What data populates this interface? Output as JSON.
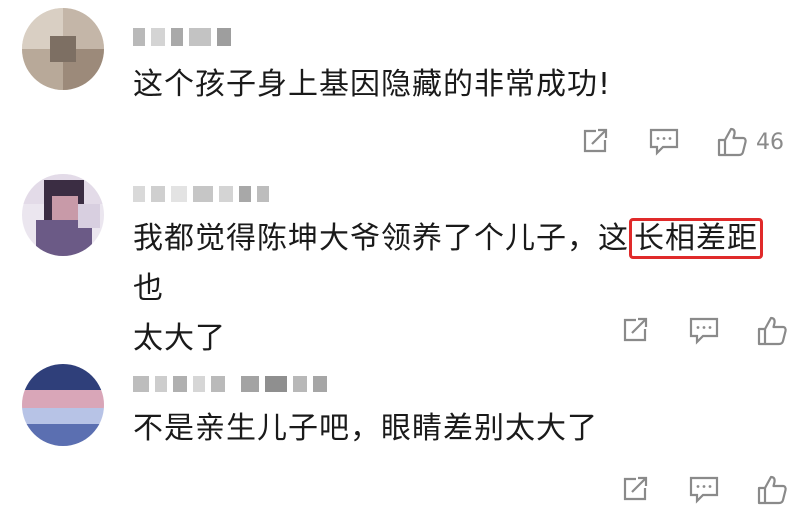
{
  "comments": [
    {
      "text": "这个孩子身上基因隐藏的非常成功!",
      "like_count": "46"
    },
    {
      "text_before": "我都觉得陈坤大爷领养了个儿子，这",
      "text_highlight": "长相差距",
      "text_after": "也",
      "text_line2": "太大了",
      "like_count": ""
    },
    {
      "text": "不是亲生儿子吧，眼睛差别太大了",
      "like_count": ""
    }
  ],
  "icons": {
    "share": "share-icon",
    "reply": "comment-icon",
    "like": "thumbs-up-icon"
  },
  "colors": {
    "highlight_border": "#e02a2a",
    "icon": "#8a8a8a",
    "text": "#1a1a1a"
  }
}
